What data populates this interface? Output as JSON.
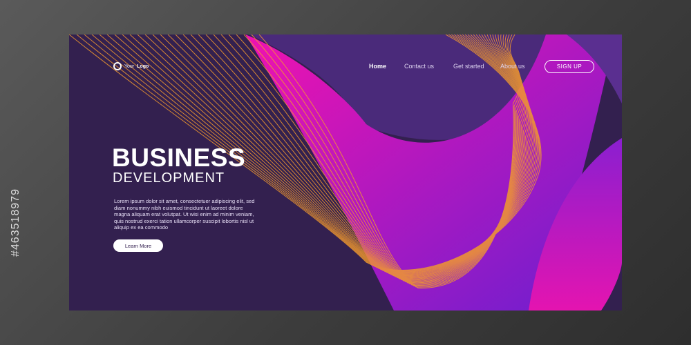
{
  "logo": {
    "prefix": "Your",
    "bold": "Logo"
  },
  "nav": {
    "items": [
      "Home",
      "Contact us",
      "Get started",
      "About us"
    ],
    "signup": "SIGN UP"
  },
  "hero": {
    "title": "BUSINESS",
    "subtitle": "DEVELOPMENT",
    "body": "Lorem ipsum dolor sit amet, consectetuer adipiscing elit, sed diam nonummy nibh euismod tincidunt ut laoreet dolore magna aliquam erat volutpat. Ut wisi enim ad minim veniam, quis nostrud exerci tation ullamcorper suscipit lobortis nisl ut aliquip ex ea commodo",
    "button": "Learn More"
  },
  "stock_id": "#463518979",
  "colors": {
    "background": "#33204f",
    "magenta": "#e514b4",
    "violet": "#7a1fd0",
    "orange": "#f29a2e"
  }
}
